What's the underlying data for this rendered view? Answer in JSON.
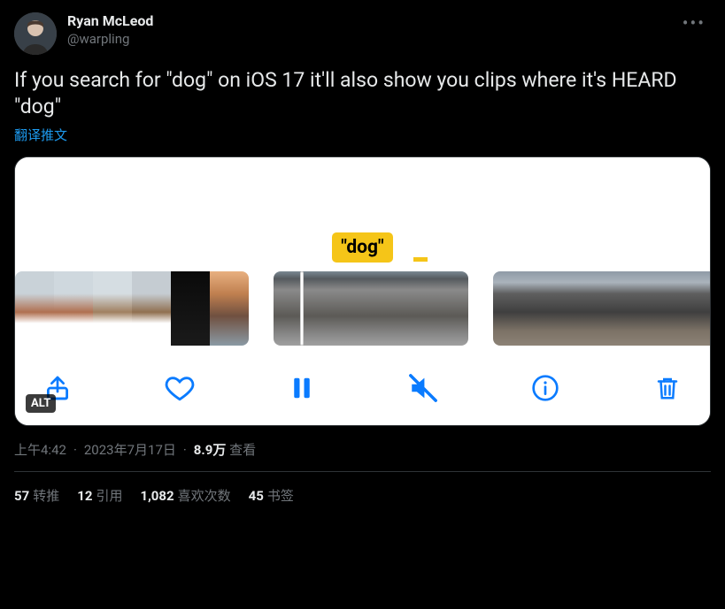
{
  "author": {
    "display_name": "Ryan McLeod",
    "handle": "@warpling"
  },
  "tweet_text": "If you search for \"dog\" on iOS 17 it'll also show you clips where it's HEARD \"dog\"",
  "translate_label": "翻译推文",
  "media": {
    "caption_label": "\"dog\"",
    "alt_badge": "ALT"
  },
  "meta": {
    "time": "上午4:42",
    "date": "2023年7月17日",
    "views_count": "8.9万",
    "views_label": "查看"
  },
  "stats": {
    "retweets_count": "57",
    "retweets_label": "转推",
    "quotes_count": "12",
    "quotes_label": "引用",
    "likes_count": "1,082",
    "likes_label": "喜欢次数",
    "bookmarks_count": "45",
    "bookmarks_label": "书签"
  }
}
